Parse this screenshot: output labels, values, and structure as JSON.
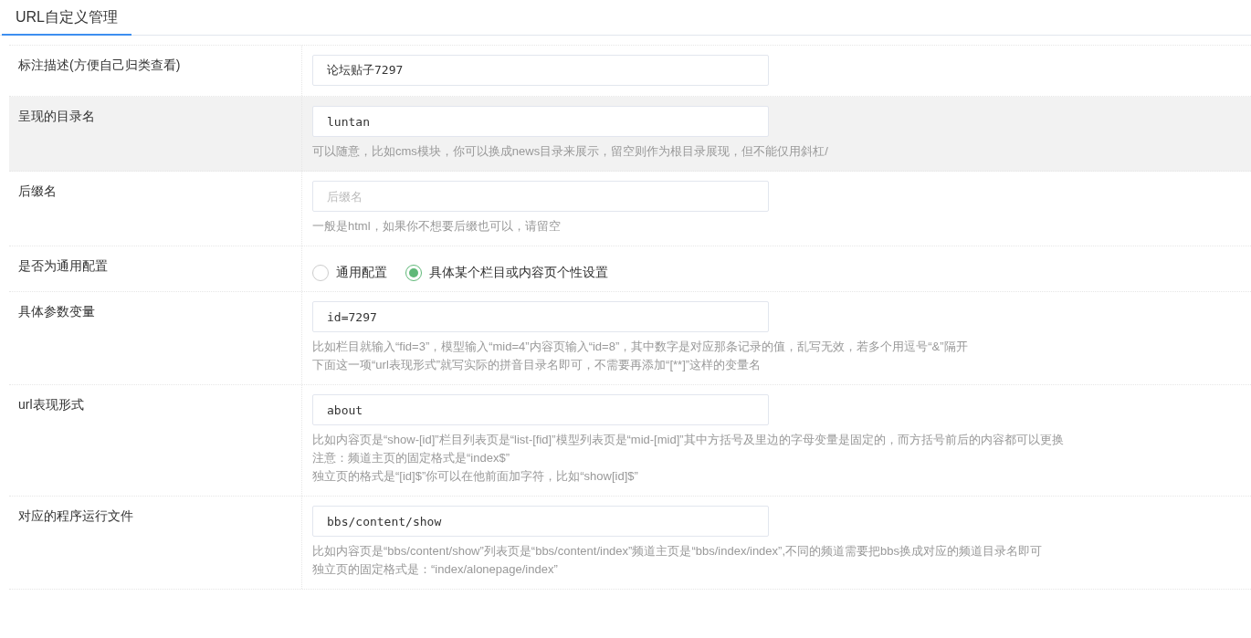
{
  "tabs": [
    {
      "label": "URL自定义管理",
      "selected": true
    }
  ],
  "rows": [
    {
      "label": "标注描述(方便自己归类查看)",
      "kind": "text",
      "highlighted": false,
      "value": "论坛贴子7297",
      "hints": []
    },
    {
      "label": "呈现的目录名",
      "kind": "text",
      "highlighted": true,
      "value": "luntan",
      "hints": [
        "可以随意，比如cms模块，你可以换成news目录来展示，留空则作为根目录展现，但不能仅用斜杠/"
      ]
    },
    {
      "label": "后缀名",
      "kind": "text",
      "highlighted": false,
      "placeholder": "后缀名",
      "hints": [
        "一般是html，如果你不想要后缀也可以，请留空"
      ]
    },
    {
      "label": "是否为通用配置",
      "kind": "radio",
      "highlighted": false,
      "options": [
        {
          "label": "通用配置",
          "selected": false
        },
        {
          "label": "具体某个栏目或内容页个性设置",
          "selected": true
        }
      ],
      "hints": []
    },
    {
      "label": "具体参数变量",
      "kind": "text",
      "highlighted": false,
      "value": "id=7297",
      "hints": [
        "比如栏目就输入“fid=3”，模型输入“mid=4”内容页输入“id=8”，其中数字是对应那条记录的值，乱写无效，若多个用逗号“&”隔开",
        "下面这一项“url表现形式”就写实际的拼音目录名即可，不需要再添加“[**]”这样的变量名"
      ]
    },
    {
      "label": "url表现形式",
      "kind": "text",
      "highlighted": false,
      "value": "about",
      "hints": [
        "比如内容页是“show-[id]”栏目列表页是“list-[fid]”模型列表页是“mid-[mid]”其中方括号及里边的字母变量是固定的，而方括号前后的内容都可以更换",
        "注意：频道主页的固定格式是“index$”",
        "独立页的格式是“[id]$”你可以在他前面加字符，比如“show[id]$”"
      ]
    },
    {
      "label": "对应的程序运行文件",
      "kind": "text",
      "highlighted": false,
      "value": "bbs/content/show",
      "hints": [
        "比如内容页是“bbs/content/show”列表页是“bbs/content/index”频道主页是“bbs/index/index”,不同的频道需要把bbs换成对应的频道目录名即可",
        "独立页的固定格式是：“index/alonepage/index”"
      ]
    }
  ]
}
